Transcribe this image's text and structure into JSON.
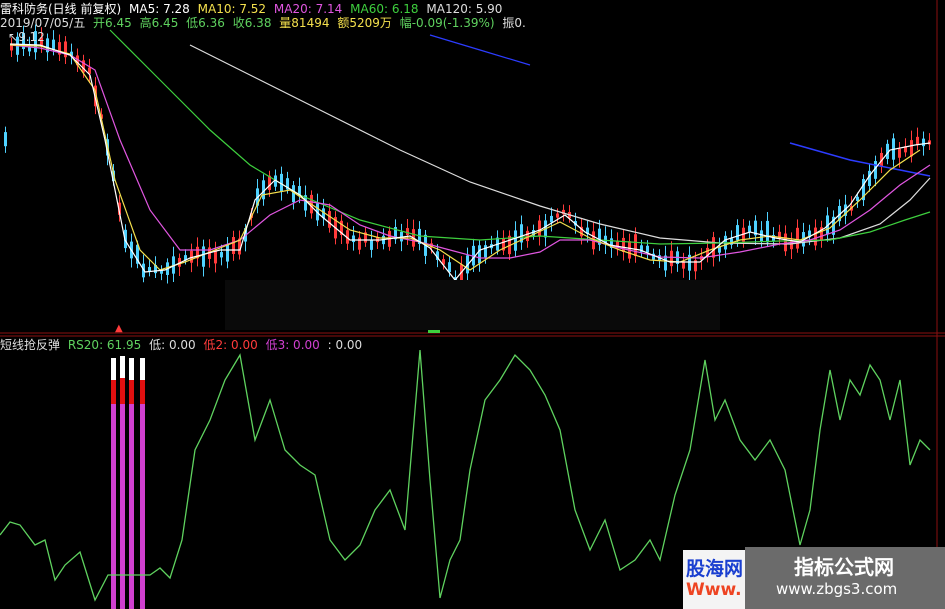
{
  "stock": {
    "name": "雷科防务(日线 前复权)",
    "ma5": "MA5: 7.28",
    "ma10": "MA10: 7.52",
    "ma20": "MA20: 7.14",
    "ma60": "MA60: 6.18",
    "ma120": "MA120: 5.90",
    "date": "2019/07/05/五",
    "open": "开6.45",
    "high": "高6.45",
    "low": "低6.36",
    "close": "收6.38",
    "volume": "量81494",
    "amount": "额5209万",
    "change": "幅-0.09(-1.39%)",
    "amplitude": "振0.",
    "price_mark": "9.12"
  },
  "indicator": {
    "name": "短线抢反弹",
    "rs20": "RS20: 61.95",
    "low1": "低: 0.00",
    "low2": "低2: 0.00",
    "low3": "低3: 0.00",
    "extra": ": 0.00"
  },
  "watermark": {
    "title": "指标公式网",
    "url": "www.zbgs3.com",
    "left_text": "股海网",
    "left_text2": "Www."
  },
  "colors": {
    "background": "#000000",
    "up": "#ff3b3b",
    "down": "#4fd2ff",
    "ma5": "#ffffff",
    "ma10": "#f4e04d",
    "ma20": "#e056e0",
    "ma60": "#3ecf3e",
    "ma120": "#dddddd",
    "rs20_line": "#5fd25f",
    "signal_bar": "#d040d0"
  }
}
